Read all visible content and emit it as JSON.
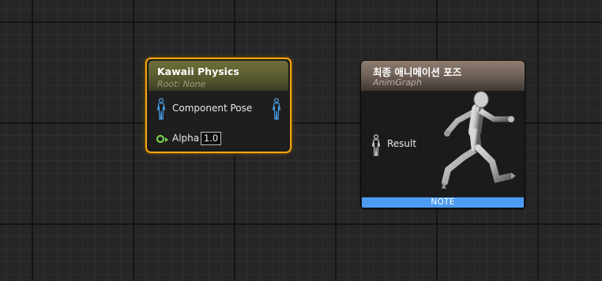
{
  "kawaii_node": {
    "title": "Kawaii Physics",
    "subtitle": "Root: None",
    "component_pose_label": "Component Pose",
    "alpha_label": "Alpha",
    "alpha_value": "1.0",
    "border_color": "#f2a612"
  },
  "final_node": {
    "title": "최종 애니메이션 포즈",
    "subtitle": "AnimGraph",
    "result_label": "Result",
    "note_label": "NOTE",
    "note_color": "#4d9bf0"
  },
  "icons": {
    "pose_pin": "person-pose-icon",
    "alpha_pin": "float-pin-icon",
    "mannequin": "running-mannequin-icon"
  }
}
